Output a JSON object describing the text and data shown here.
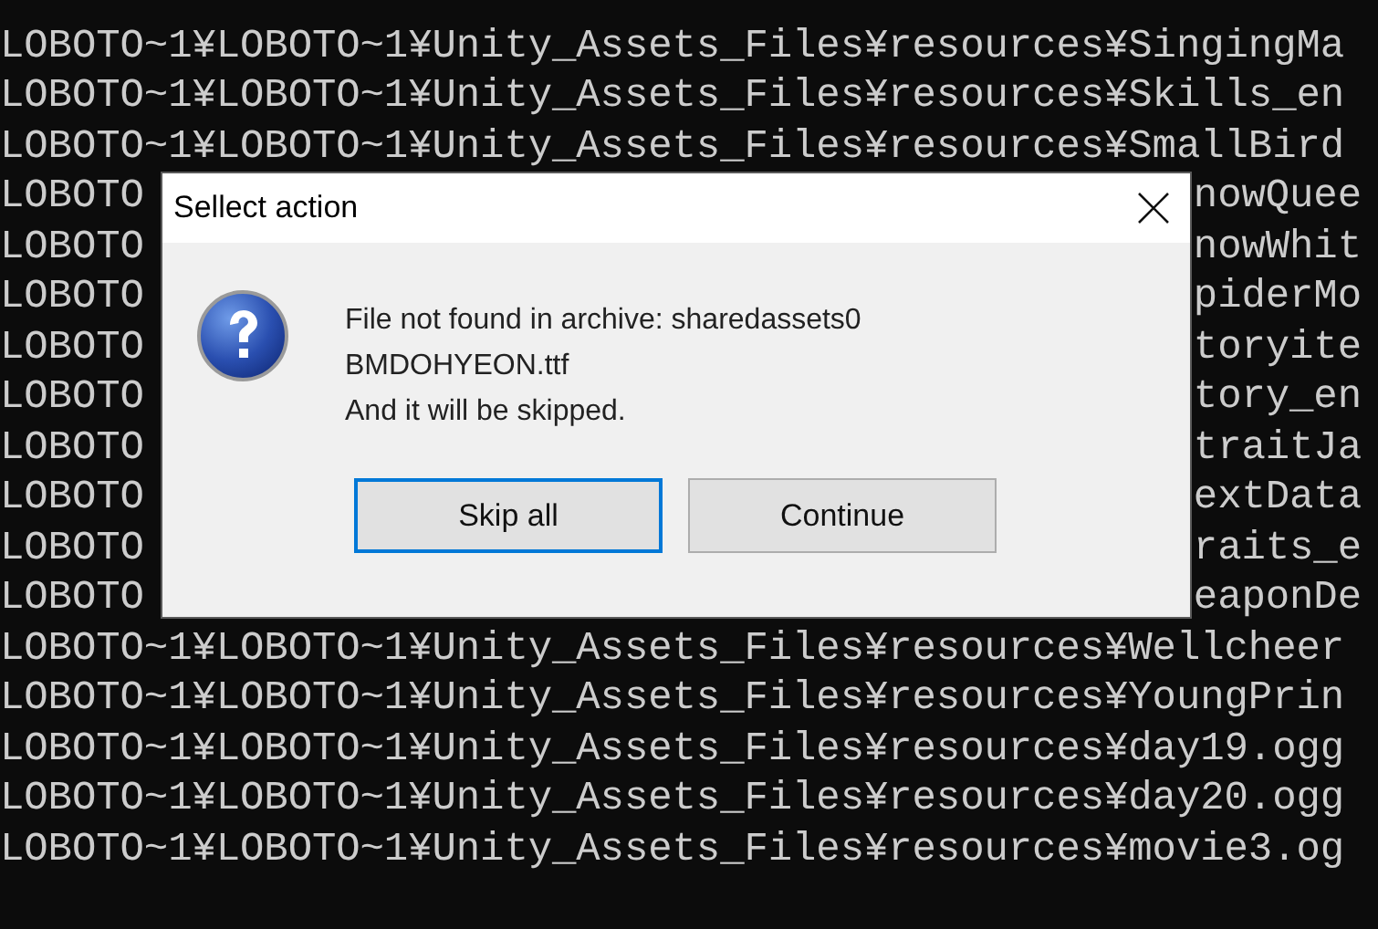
{
  "console": {
    "lines": [
      {
        "kind": "full",
        "text": "LOBOTO~1¥LOBOTO~1¥Unity_Assets_Files¥resources¥SingingMa"
      },
      {
        "kind": "full",
        "text": "LOBOTO~1¥LOBOTO~1¥Unity_Assets_Files¥resources¥Skills_en"
      },
      {
        "kind": "full",
        "text": "LOBOTO~1¥LOBOTO~1¥Unity_Assets_Files¥resources¥SmallBird"
      },
      {
        "kind": "covered",
        "left": "LOBOTO",
        "right": "nowQuee"
      },
      {
        "kind": "covered",
        "left": "LOBOTO",
        "right": "nowWhit"
      },
      {
        "kind": "covered",
        "left": "LOBOTO",
        "right": "piderMo"
      },
      {
        "kind": "covered",
        "left": "LOBOTO",
        "right": "toryite"
      },
      {
        "kind": "covered",
        "left": "LOBOTO",
        "right": "tory_en"
      },
      {
        "kind": "covered",
        "left": "LOBOTO",
        "right": "traitJa"
      },
      {
        "kind": "covered",
        "left": "LOBOTO",
        "right": "extData"
      },
      {
        "kind": "covered",
        "left": "LOBOTO",
        "right": "raits_e"
      },
      {
        "kind": "covered",
        "left": "LOBOTO",
        "right": "eaponDe"
      },
      {
        "kind": "full",
        "text": "LOBOTO~1¥LOBOTO~1¥Unity_Assets_Files¥resources¥Wellcheer"
      },
      {
        "kind": "full",
        "text": "LOBOTO~1¥LOBOTO~1¥Unity_Assets_Files¥resources¥YoungPrin"
      },
      {
        "kind": "full",
        "text": "LOBOTO~1¥LOBOTO~1¥Unity_Assets_Files¥resources¥day19.ogg"
      },
      {
        "kind": "full",
        "text": "LOBOTO~1¥LOBOTO~1¥Unity_Assets_Files¥resources¥day20.ogg"
      },
      {
        "kind": "full",
        "text": "LOBOTO~1¥LOBOTO~1¥Unity_Assets_Files¥resources¥movie3.og"
      }
    ]
  },
  "dialog": {
    "title": "Sellect action",
    "message": [
      "File not found in archive: sharedassets0",
      "BMDOHYEON.ttf",
      "And it will be skipped."
    ],
    "buttons": [
      {
        "label": "Skip all",
        "selected": true
      },
      {
        "label": "Continue",
        "selected": false
      }
    ]
  }
}
